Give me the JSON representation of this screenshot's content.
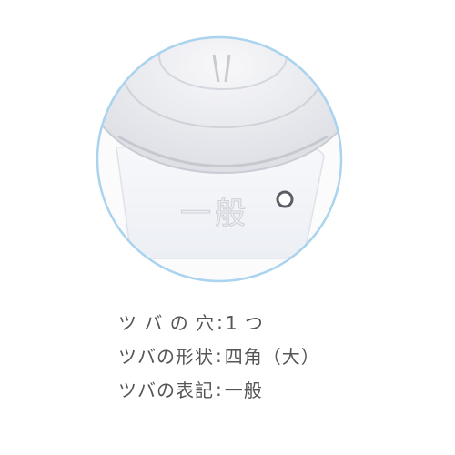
{
  "product": {
    "engraved_text": "一般",
    "frame_color": "#a9d3ee"
  },
  "specs": [
    {
      "label": "ツ バ の 穴",
      "separator": ":",
      "value": "1 つ"
    },
    {
      "label": "ツバの形状",
      "separator": ":",
      "value": "四角（大）"
    },
    {
      "label": "ツバの表記",
      "separator": ":",
      "value": "一般"
    }
  ]
}
